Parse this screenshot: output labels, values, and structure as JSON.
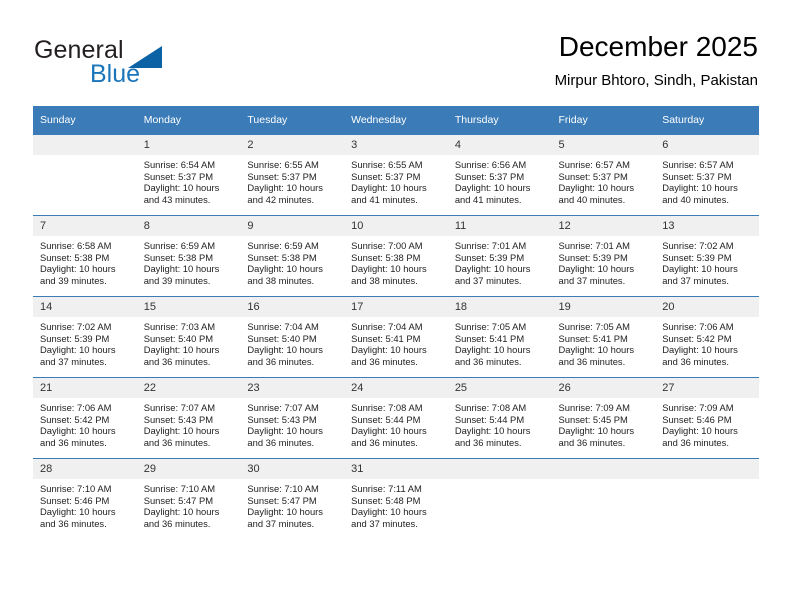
{
  "brand": {
    "name_part1": "General",
    "name_part2": "Blue",
    "triangle_color": "#0b62a4",
    "blue_color": "#1b75bb"
  },
  "header": {
    "title": "December 2025",
    "subtitle": "Mirpur Bhtoro, Sindh, Pakistan"
  },
  "theme": {
    "header_bg": "#3b7cb8",
    "daynum_bg": "#f0f0f0",
    "cell_bg": "#ffffff"
  },
  "weekdays": [
    "Sunday",
    "Monday",
    "Tuesday",
    "Wednesday",
    "Thursday",
    "Friday",
    "Saturday"
  ],
  "weeks": [
    [
      {
        "day": "",
        "empty": true
      },
      {
        "day": "1",
        "sunrise": "Sunrise: 6:54 AM",
        "sunset": "Sunset: 5:37 PM",
        "daylight_l1": "Daylight: 10 hours",
        "daylight_l2": "and 43 minutes."
      },
      {
        "day": "2",
        "sunrise": "Sunrise: 6:55 AM",
        "sunset": "Sunset: 5:37 PM",
        "daylight_l1": "Daylight: 10 hours",
        "daylight_l2": "and 42 minutes."
      },
      {
        "day": "3",
        "sunrise": "Sunrise: 6:55 AM",
        "sunset": "Sunset: 5:37 PM",
        "daylight_l1": "Daylight: 10 hours",
        "daylight_l2": "and 41 minutes."
      },
      {
        "day": "4",
        "sunrise": "Sunrise: 6:56 AM",
        "sunset": "Sunset: 5:37 PM",
        "daylight_l1": "Daylight: 10 hours",
        "daylight_l2": "and 41 minutes."
      },
      {
        "day": "5",
        "sunrise": "Sunrise: 6:57 AM",
        "sunset": "Sunset: 5:37 PM",
        "daylight_l1": "Daylight: 10 hours",
        "daylight_l2": "and 40 minutes."
      },
      {
        "day": "6",
        "sunrise": "Sunrise: 6:57 AM",
        "sunset": "Sunset: 5:37 PM",
        "daylight_l1": "Daylight: 10 hours",
        "daylight_l2": "and 40 minutes."
      }
    ],
    [
      {
        "day": "7",
        "sunrise": "Sunrise: 6:58 AM",
        "sunset": "Sunset: 5:38 PM",
        "daylight_l1": "Daylight: 10 hours",
        "daylight_l2": "and 39 minutes."
      },
      {
        "day": "8",
        "sunrise": "Sunrise: 6:59 AM",
        "sunset": "Sunset: 5:38 PM",
        "daylight_l1": "Daylight: 10 hours",
        "daylight_l2": "and 39 minutes."
      },
      {
        "day": "9",
        "sunrise": "Sunrise: 6:59 AM",
        "sunset": "Sunset: 5:38 PM",
        "daylight_l1": "Daylight: 10 hours",
        "daylight_l2": "and 38 minutes."
      },
      {
        "day": "10",
        "sunrise": "Sunrise: 7:00 AM",
        "sunset": "Sunset: 5:38 PM",
        "daylight_l1": "Daylight: 10 hours",
        "daylight_l2": "and 38 minutes."
      },
      {
        "day": "11",
        "sunrise": "Sunrise: 7:01 AM",
        "sunset": "Sunset: 5:39 PM",
        "daylight_l1": "Daylight: 10 hours",
        "daylight_l2": "and 37 minutes."
      },
      {
        "day": "12",
        "sunrise": "Sunrise: 7:01 AM",
        "sunset": "Sunset: 5:39 PM",
        "daylight_l1": "Daylight: 10 hours",
        "daylight_l2": "and 37 minutes."
      },
      {
        "day": "13",
        "sunrise": "Sunrise: 7:02 AM",
        "sunset": "Sunset: 5:39 PM",
        "daylight_l1": "Daylight: 10 hours",
        "daylight_l2": "and 37 minutes."
      }
    ],
    [
      {
        "day": "14",
        "sunrise": "Sunrise: 7:02 AM",
        "sunset": "Sunset: 5:39 PM",
        "daylight_l1": "Daylight: 10 hours",
        "daylight_l2": "and 37 minutes."
      },
      {
        "day": "15",
        "sunrise": "Sunrise: 7:03 AM",
        "sunset": "Sunset: 5:40 PM",
        "daylight_l1": "Daylight: 10 hours",
        "daylight_l2": "and 36 minutes."
      },
      {
        "day": "16",
        "sunrise": "Sunrise: 7:04 AM",
        "sunset": "Sunset: 5:40 PM",
        "daylight_l1": "Daylight: 10 hours",
        "daylight_l2": "and 36 minutes."
      },
      {
        "day": "17",
        "sunrise": "Sunrise: 7:04 AM",
        "sunset": "Sunset: 5:41 PM",
        "daylight_l1": "Daylight: 10 hours",
        "daylight_l2": "and 36 minutes."
      },
      {
        "day": "18",
        "sunrise": "Sunrise: 7:05 AM",
        "sunset": "Sunset: 5:41 PM",
        "daylight_l1": "Daylight: 10 hours",
        "daylight_l2": "and 36 minutes."
      },
      {
        "day": "19",
        "sunrise": "Sunrise: 7:05 AM",
        "sunset": "Sunset: 5:41 PM",
        "daylight_l1": "Daylight: 10 hours",
        "daylight_l2": "and 36 minutes."
      },
      {
        "day": "20",
        "sunrise": "Sunrise: 7:06 AM",
        "sunset": "Sunset: 5:42 PM",
        "daylight_l1": "Daylight: 10 hours",
        "daylight_l2": "and 36 minutes."
      }
    ],
    [
      {
        "day": "21",
        "sunrise": "Sunrise: 7:06 AM",
        "sunset": "Sunset: 5:42 PM",
        "daylight_l1": "Daylight: 10 hours",
        "daylight_l2": "and 36 minutes."
      },
      {
        "day": "22",
        "sunrise": "Sunrise: 7:07 AM",
        "sunset": "Sunset: 5:43 PM",
        "daylight_l1": "Daylight: 10 hours",
        "daylight_l2": "and 36 minutes."
      },
      {
        "day": "23",
        "sunrise": "Sunrise: 7:07 AM",
        "sunset": "Sunset: 5:43 PM",
        "daylight_l1": "Daylight: 10 hours",
        "daylight_l2": "and 36 minutes."
      },
      {
        "day": "24",
        "sunrise": "Sunrise: 7:08 AM",
        "sunset": "Sunset: 5:44 PM",
        "daylight_l1": "Daylight: 10 hours",
        "daylight_l2": "and 36 minutes."
      },
      {
        "day": "25",
        "sunrise": "Sunrise: 7:08 AM",
        "sunset": "Sunset: 5:44 PM",
        "daylight_l1": "Daylight: 10 hours",
        "daylight_l2": "and 36 minutes."
      },
      {
        "day": "26",
        "sunrise": "Sunrise: 7:09 AM",
        "sunset": "Sunset: 5:45 PM",
        "daylight_l1": "Daylight: 10 hours",
        "daylight_l2": "and 36 minutes."
      },
      {
        "day": "27",
        "sunrise": "Sunrise: 7:09 AM",
        "sunset": "Sunset: 5:46 PM",
        "daylight_l1": "Daylight: 10 hours",
        "daylight_l2": "and 36 minutes."
      }
    ],
    [
      {
        "day": "28",
        "sunrise": "Sunrise: 7:10 AM",
        "sunset": "Sunset: 5:46 PM",
        "daylight_l1": "Daylight: 10 hours",
        "daylight_l2": "and 36 minutes."
      },
      {
        "day": "29",
        "sunrise": "Sunrise: 7:10 AM",
        "sunset": "Sunset: 5:47 PM",
        "daylight_l1": "Daylight: 10 hours",
        "daylight_l2": "and 36 minutes."
      },
      {
        "day": "30",
        "sunrise": "Sunrise: 7:10 AM",
        "sunset": "Sunset: 5:47 PM",
        "daylight_l1": "Daylight: 10 hours",
        "daylight_l2": "and 37 minutes."
      },
      {
        "day": "31",
        "sunrise": "Sunrise: 7:11 AM",
        "sunset": "Sunset: 5:48 PM",
        "daylight_l1": "Daylight: 10 hours",
        "daylight_l2": "and 37 minutes."
      },
      {
        "day": "",
        "empty": true
      },
      {
        "day": "",
        "empty": true
      },
      {
        "day": "",
        "empty": true
      }
    ]
  ]
}
